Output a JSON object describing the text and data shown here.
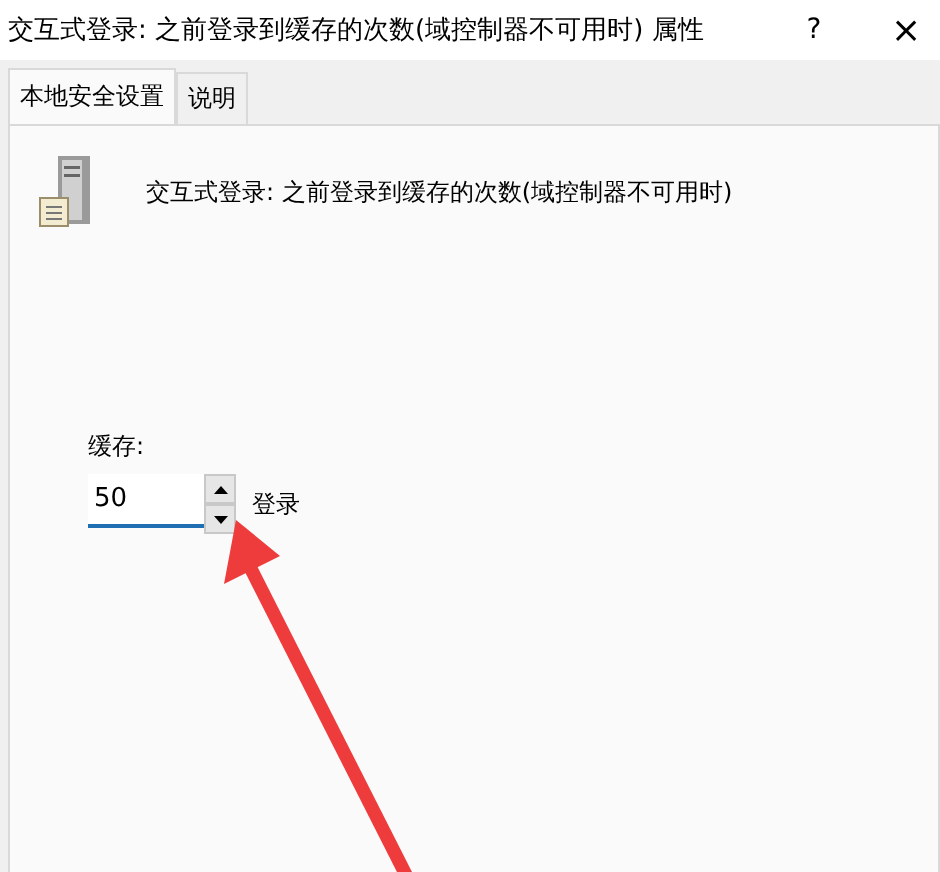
{
  "window": {
    "title": "交互式登录: 之前登录到缓存的次数(域控制器不可用时) 属性",
    "help": "?",
    "close": "×"
  },
  "tabs": [
    {
      "label": "本地安全设置",
      "selected": true
    },
    {
      "label": "说明",
      "selected": false
    }
  ],
  "policy": {
    "name": "交互式登录: 之前登录到缓存的次数(域控制器不可用时)"
  },
  "setting": {
    "label": "缓存:",
    "value": "50",
    "unit": "登录"
  }
}
